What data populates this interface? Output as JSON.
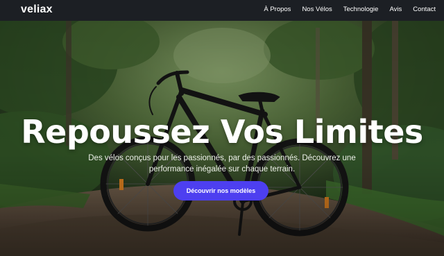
{
  "nav": {
    "logo": "veliax",
    "links": [
      "À Propos",
      "Nos Vélos",
      "Technologie",
      "Avis",
      "Contact"
    ]
  },
  "hero": {
    "title": "Repoussez Vos Limites",
    "subtitle": "Des vélos conçus pour les passionnés, par des passionnés. Découvrez une performance inégalée sur chaque terrain.",
    "cta_label": "Découvrir nos modèles",
    "background": "hybrid-bicycle-on-forest-path"
  },
  "colors": {
    "navbar": "#1c1f24",
    "accent": "#4d3ff0",
    "text": "#ffffff"
  }
}
